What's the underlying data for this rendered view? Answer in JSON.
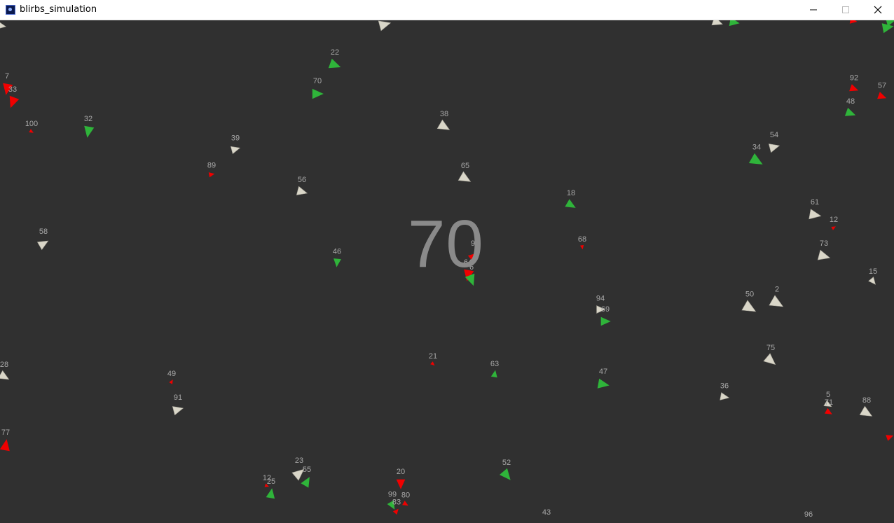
{
  "window": {
    "title": "blirbs_simulation",
    "controls": {
      "minimize": "minimize-icon",
      "maximize": "maximize-icon",
      "close": "close-icon"
    }
  },
  "simulation": {
    "counter": "70",
    "colors": {
      "background": "#303030",
      "white": "#d9d6c8",
      "green": "#2fb43a",
      "red": "#f00000",
      "label": "#a8a8a8",
      "counter": "#8a8a8a"
    },
    "labels": [
      "7",
      "33",
      "100",
      "32",
      "22",
      "70",
      "39",
      "89",
      "56",
      "58",
      "46",
      "38",
      "65",
      "18",
      "68",
      "95",
      "64",
      "6",
      "94",
      "69",
      "21",
      "63",
      "47",
      "49",
      "91",
      "28",
      "77",
      "23",
      "55",
      "12",
      "25",
      "20",
      "99",
      "83",
      "80",
      "52",
      "43",
      "96",
      "92",
      "57",
      "48",
      "54",
      "34",
      "61",
      "12",
      "73",
      "15",
      "50",
      "2",
      "75",
      "36",
      "5",
      "71",
      "88"
    ]
  }
}
